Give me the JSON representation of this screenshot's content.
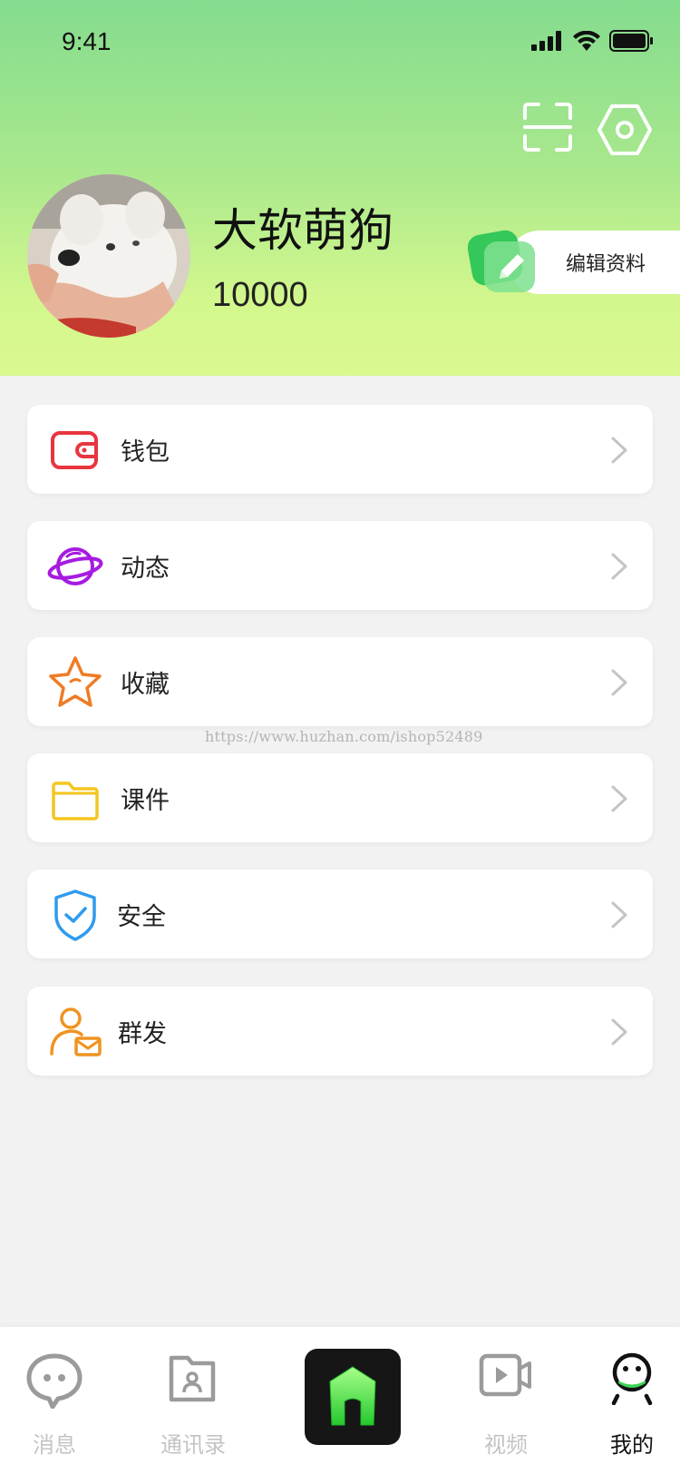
{
  "status_bar": {
    "time": "9:41"
  },
  "header": {
    "scan_icon": "scan-icon",
    "settings_icon": "settings-hexagon-icon",
    "profile": {
      "name": "大软萌狗",
      "id": "10000",
      "edit_label": "编辑资料"
    }
  },
  "menu": {
    "items": [
      {
        "label": "钱包",
        "icon": "wallet-icon",
        "color": "#e8353e"
      },
      {
        "label": "动态",
        "icon": "planet-icon",
        "color": "#a61be0"
      },
      {
        "label": "收藏",
        "icon": "star-icon",
        "color": "#ef7b24"
      },
      {
        "label": "课件",
        "icon": "folder-icon",
        "color": "#f5c51f"
      },
      {
        "label": "安全",
        "icon": "shield-check-icon",
        "color": "#2e9bef"
      },
      {
        "label": "群发",
        "icon": "user-mail-icon",
        "color": "#ef9320"
      }
    ]
  },
  "watermark": "https://www.huzhan.com/ishop52489",
  "tabbar": {
    "tabs": [
      {
        "label": "消息",
        "icon": "chat-icon",
        "active": false
      },
      {
        "label": "通讯录",
        "icon": "contacts-icon",
        "active": false
      },
      {
        "label": "",
        "icon": "home-icon",
        "active": false
      },
      {
        "label": "视频",
        "icon": "video-icon",
        "active": false
      },
      {
        "label": "我的",
        "icon": "profile-face-icon",
        "active": true
      }
    ]
  },
  "colors": {
    "header_top": "#84dc8e",
    "header_bottom": "#daf990",
    "tab_inactive": "#c4c4c4",
    "tab_active": "#111111"
  }
}
